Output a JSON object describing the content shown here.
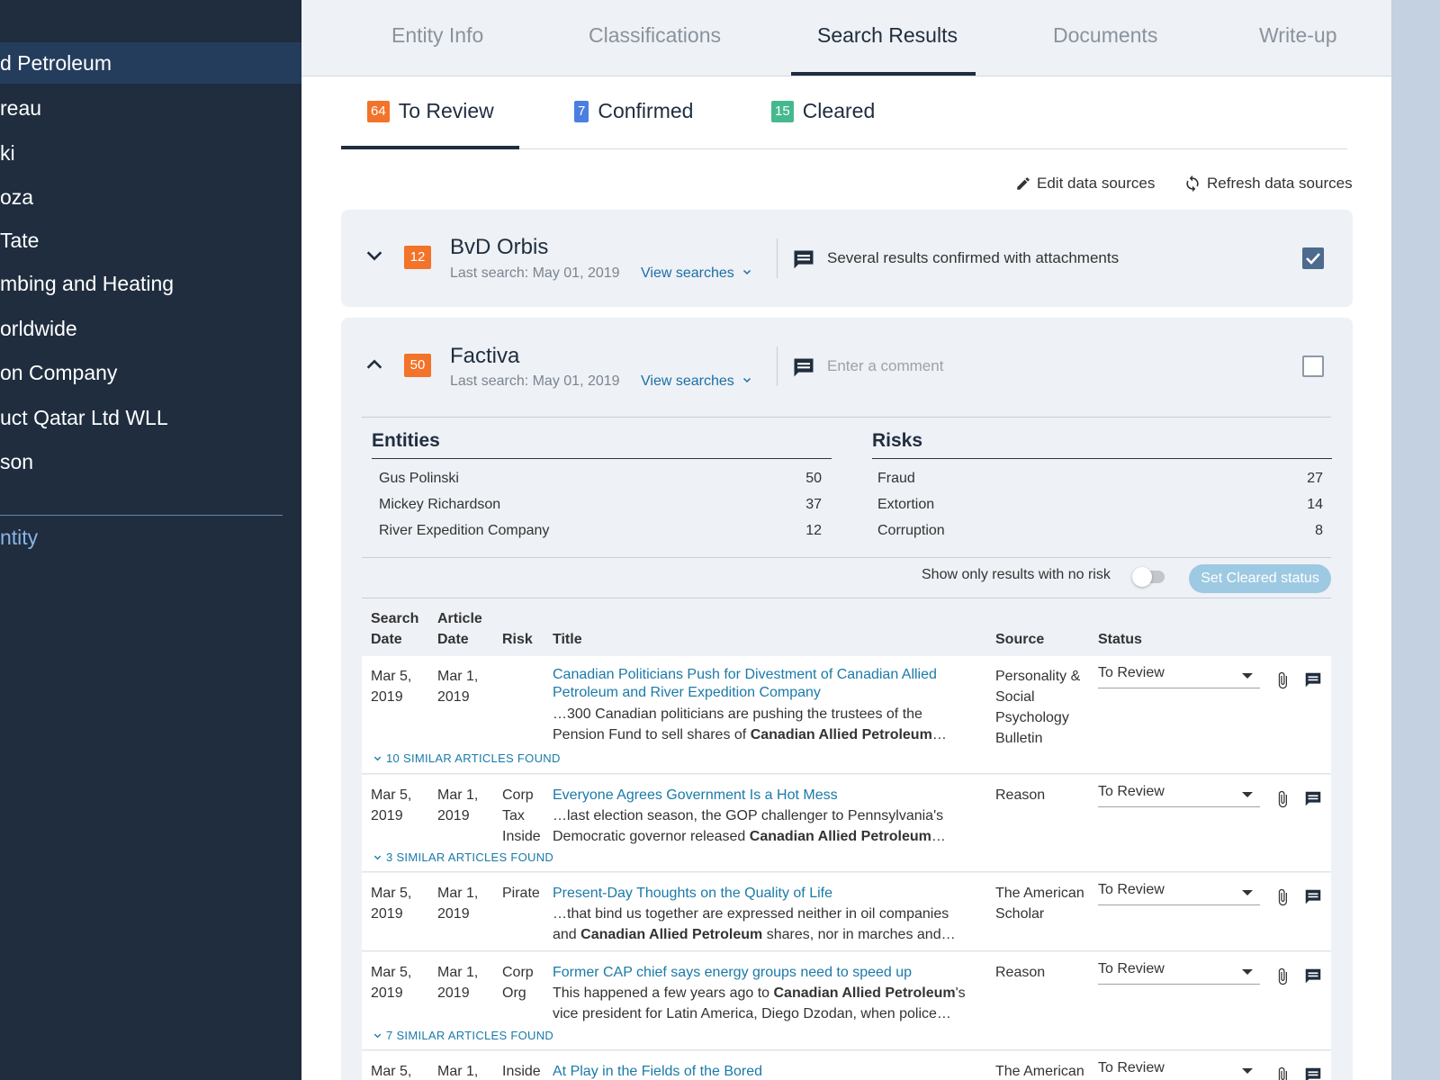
{
  "sidebar": {
    "items": [
      {
        "label": "d Petroleum",
        "active": true
      },
      {
        "label": "reau"
      },
      {
        "label": "ki"
      },
      {
        "label": "oza"
      },
      {
        "label": "Tate"
      },
      {
        "label": "mbing and Heating"
      },
      {
        "label": "orldwide"
      },
      {
        "label": "on Company"
      },
      {
        "label": "uct Qatar Ltd WLL"
      },
      {
        "label": "son"
      }
    ],
    "new_entity": "ntity"
  },
  "topnav": {
    "tabs": [
      "Entity Info",
      "Classifications",
      "Search Results",
      "Documents",
      "Write-up"
    ]
  },
  "subtabs": [
    {
      "count": "64",
      "label": "To Review"
    },
    {
      "count": "7",
      "label": "Confirmed"
    },
    {
      "count": "15",
      "label": "Cleared"
    }
  ],
  "actions": {
    "edit": "Edit data sources",
    "refresh": "Refresh data sources"
  },
  "sources": {
    "bvd": {
      "count": "12",
      "name": "BvD Orbis",
      "last_search": "Last search: May 01, 2019",
      "view_searches": "View searches",
      "comment": "Several results confirmed with attachments",
      "checked": true
    },
    "factiva": {
      "count": "50",
      "name": "Factiva",
      "last_search": "Last search: May 01, 2019",
      "view_searches": "View searches",
      "comment_placeholder": "Enter a comment",
      "checked": false
    }
  },
  "entities": {
    "heading": "Entities",
    "rows": [
      {
        "name": "Gus Polinski",
        "count": "50"
      },
      {
        "name": "Mickey Richardson",
        "count": "37"
      },
      {
        "name": "River Expedition Company",
        "count": "12"
      }
    ]
  },
  "risks": {
    "heading": "Risks",
    "rows": [
      {
        "name": "Fraud",
        "count": "27"
      },
      {
        "name": "Extortion",
        "count": "14"
      },
      {
        "name": "Corruption",
        "count": "8"
      }
    ]
  },
  "filter": {
    "toggle_label": "Show only results with no risk",
    "set_cleared": "Set Cleared status"
  },
  "table": {
    "headers": {
      "search_date_1": "Search",
      "search_date_2": "Date",
      "article_date_1": "Article",
      "article_date_2": "Date",
      "risk": "Risk",
      "title": "Title",
      "source": "Source",
      "status": "Status"
    },
    "rows": [
      {
        "search_date_1": "Mar 5,",
        "search_date_2": "2019",
        "article_date_1": "Mar 1,",
        "article_date_2": "2019",
        "risk": "",
        "title": "Canadian Politicians Push for Divestment of Canadian Allied Petroleum and River Expedition Company",
        "snippet_pre": "…300 Canadian politicians are pushing the trustees of the Pension Fund to sell shares of ",
        "snippet_bold": "Canadian Allied Petroleum",
        "snippet_post": "…",
        "source": "Personality & Social Psychology Bulletin",
        "status": "To Review",
        "similar": "10 SIMILAR ARTICLES FOUND"
      },
      {
        "search_date_1": "Mar 5,",
        "search_date_2": "2019",
        "article_date_1": "Mar 1,",
        "article_date_2": "2019",
        "risk": "Corp Tax Inside",
        "title": "Everyone Agrees Government Is a Hot Mess",
        "snippet_pre": "…last election season, the GOP challenger to Pennsylvania's Democratic governor released ",
        "snippet_bold": "Canadian Allied Petroleum",
        "snippet_post": "…",
        "source": "Reason",
        "status": "To Review",
        "similar": "3 SIMILAR ARTICLES FOUND"
      },
      {
        "search_date_1": "Mar 5,",
        "search_date_2": "2019",
        "article_date_1": "Mar 1,",
        "article_date_2": "2019",
        "risk": "Pirate",
        "title": "Present-Day Thoughts on the Quality of Life",
        "snippet_pre": "…that bind us together are expressed neither in oil companies and ",
        "snippet_bold": "Canadian Allied Petroleum",
        "snippet_post": " shares, nor in marches and…",
        "source": "The American Scholar",
        "status": "To Review",
        "similar": ""
      },
      {
        "search_date_1": "Mar 5,",
        "search_date_2": "2019",
        "article_date_1": "Mar 1,",
        "article_date_2": "2019",
        "risk": "Corp Org",
        "title": "Former CAP chief says energy groups need to speed up",
        "snippet_pre": "This happened a few years ago to ",
        "snippet_bold": "Canadian Allied Petroleum",
        "snippet_post": "'s vice president for Latin America, Diego Dzodan, when police…",
        "source": "Reason",
        "status": "To Review",
        "similar": "7 SIMILAR ARTICLES FOUND"
      },
      {
        "search_date_1": "Mar 5,",
        "search_date_2": "",
        "article_date_1": "Mar 1,",
        "article_date_2": "",
        "risk": "Inside",
        "title": "At Play in the Fields of the Bored",
        "snippet_pre": "",
        "snippet_bold": "",
        "snippet_post": "",
        "source": "The American",
        "status": "To Review",
        "similar": ""
      }
    ]
  }
}
